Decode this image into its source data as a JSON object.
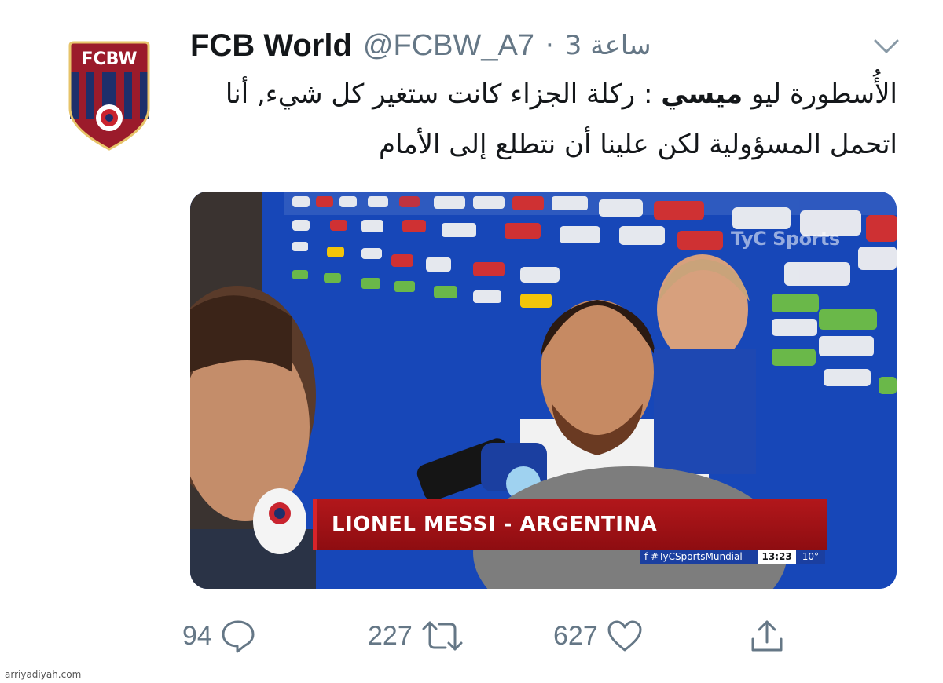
{
  "tweet": {
    "author_name": "FCB World",
    "handle": "@FCBW_A7",
    "separator": "·",
    "time": "3 ساعة",
    "avatar_text": "FCBW",
    "text_part1": "الأُسطورة ليو",
    "text_bold": "ميسي",
    "text_part2": ": ركلة الجزاء كانت ستغير كل شيء, أنا اتحمل المسؤولية لكن علينا أن نتطلع إلى الأمام"
  },
  "media": {
    "caption": "LIONEL MESSI - ARGENTINA",
    "ticker_tag": "f  #TyCSportsMundial",
    "ticker_time": "13:23",
    "ticker_temp": "10°",
    "watermark": "TyC Sports"
  },
  "actions": {
    "reply_count": "94",
    "retweet_count": "227",
    "like_count": "627"
  },
  "source_label": "arriyadiyah.com",
  "colors": {
    "accent": "#1da1f2",
    "muted": "#657786",
    "backdrop_blue": "#1747b8",
    "banner_red": "#b2171b"
  },
  "icons": [
    "chevron-down-icon",
    "reply-icon",
    "retweet-icon",
    "like-icon",
    "share-icon"
  ]
}
